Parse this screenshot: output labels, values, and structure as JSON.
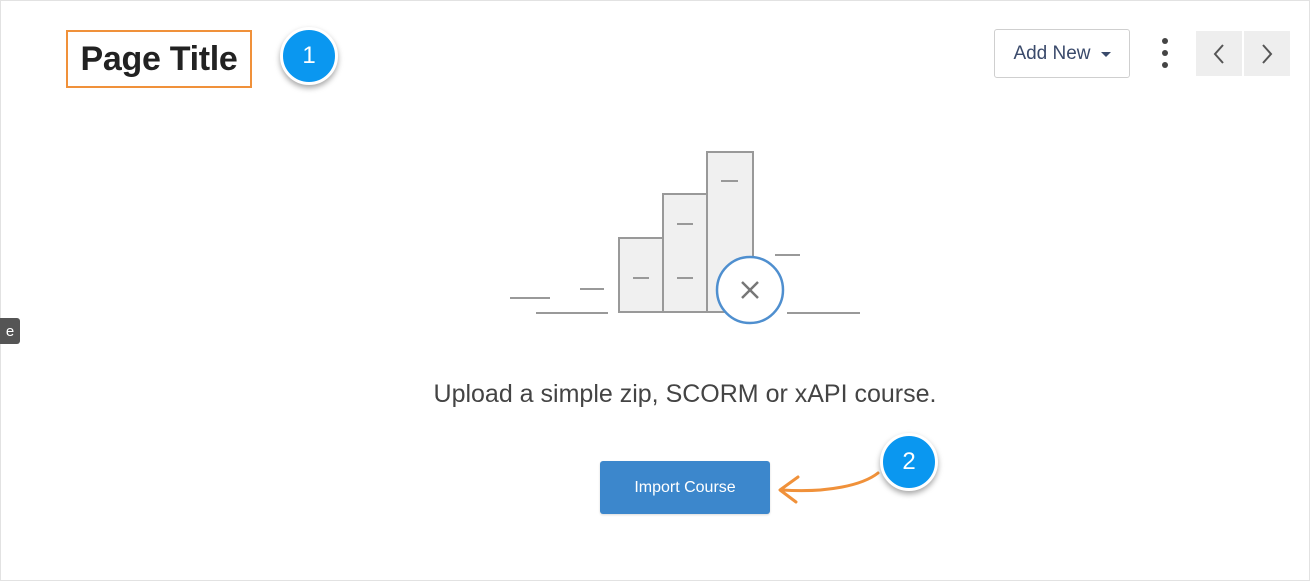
{
  "header": {
    "page_title": "Page Title",
    "add_new_label": "Add New"
  },
  "annotations": {
    "badge_1": "1",
    "badge_2": "2",
    "badge_color": "#0a97f0",
    "highlight_color": "#f0913a",
    "arrow_color": "#f0913a"
  },
  "sidebar": {
    "tab_label": "e"
  },
  "empty_state": {
    "message": "Upload a simple zip, SCORM or xAPI course.",
    "import_label": "Import Course",
    "accent_color": "#3c87cc"
  },
  "icons": {
    "more": "more-vertical-icon",
    "prev": "chevron-left-icon",
    "next": "chevron-right-icon",
    "dropdown": "caret-down-icon",
    "illustration": "empty-chart-illustration",
    "error_mark": "close-circle-icon"
  }
}
